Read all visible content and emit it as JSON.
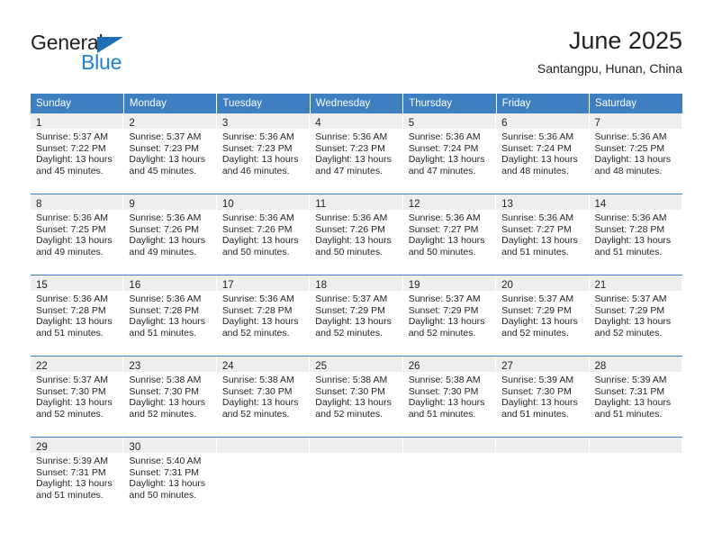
{
  "brand": {
    "line1": "General",
    "line2": "Blue",
    "triangle_color": "#1c6fb5",
    "blue_color": "#1c7fd6"
  },
  "header": {
    "title": "June 2025",
    "subtitle": "Santangpu, Hunan, China"
  },
  "theme": {
    "header_bg": "#3d7fc1",
    "daynum_bg": "#eeeeee",
    "row_divider": "#3d7fc1",
    "text": "#231f20"
  },
  "weekdays": [
    "Sunday",
    "Monday",
    "Tuesday",
    "Wednesday",
    "Thursday",
    "Friday",
    "Saturday"
  ],
  "weeks": [
    [
      {
        "day": "1",
        "sunrise": "Sunrise: 5:37 AM",
        "sunset": "Sunset: 7:22 PM",
        "daylight1": "Daylight: 13 hours",
        "daylight2": "and 45 minutes."
      },
      {
        "day": "2",
        "sunrise": "Sunrise: 5:37 AM",
        "sunset": "Sunset: 7:23 PM",
        "daylight1": "Daylight: 13 hours",
        "daylight2": "and 45 minutes."
      },
      {
        "day": "3",
        "sunrise": "Sunrise: 5:36 AM",
        "sunset": "Sunset: 7:23 PM",
        "daylight1": "Daylight: 13 hours",
        "daylight2": "and 46 minutes."
      },
      {
        "day": "4",
        "sunrise": "Sunrise: 5:36 AM",
        "sunset": "Sunset: 7:23 PM",
        "daylight1": "Daylight: 13 hours",
        "daylight2": "and 47 minutes."
      },
      {
        "day": "5",
        "sunrise": "Sunrise: 5:36 AM",
        "sunset": "Sunset: 7:24 PM",
        "daylight1": "Daylight: 13 hours",
        "daylight2": "and 47 minutes."
      },
      {
        "day": "6",
        "sunrise": "Sunrise: 5:36 AM",
        "sunset": "Sunset: 7:24 PM",
        "daylight1": "Daylight: 13 hours",
        "daylight2": "and 48 minutes."
      },
      {
        "day": "7",
        "sunrise": "Sunrise: 5:36 AM",
        "sunset": "Sunset: 7:25 PM",
        "daylight1": "Daylight: 13 hours",
        "daylight2": "and 48 minutes."
      }
    ],
    [
      {
        "day": "8",
        "sunrise": "Sunrise: 5:36 AM",
        "sunset": "Sunset: 7:25 PM",
        "daylight1": "Daylight: 13 hours",
        "daylight2": "and 49 minutes."
      },
      {
        "day": "9",
        "sunrise": "Sunrise: 5:36 AM",
        "sunset": "Sunset: 7:26 PM",
        "daylight1": "Daylight: 13 hours",
        "daylight2": "and 49 minutes."
      },
      {
        "day": "10",
        "sunrise": "Sunrise: 5:36 AM",
        "sunset": "Sunset: 7:26 PM",
        "daylight1": "Daylight: 13 hours",
        "daylight2": "and 50 minutes."
      },
      {
        "day": "11",
        "sunrise": "Sunrise: 5:36 AM",
        "sunset": "Sunset: 7:26 PM",
        "daylight1": "Daylight: 13 hours",
        "daylight2": "and 50 minutes."
      },
      {
        "day": "12",
        "sunrise": "Sunrise: 5:36 AM",
        "sunset": "Sunset: 7:27 PM",
        "daylight1": "Daylight: 13 hours",
        "daylight2": "and 50 minutes."
      },
      {
        "day": "13",
        "sunrise": "Sunrise: 5:36 AM",
        "sunset": "Sunset: 7:27 PM",
        "daylight1": "Daylight: 13 hours",
        "daylight2": "and 51 minutes."
      },
      {
        "day": "14",
        "sunrise": "Sunrise: 5:36 AM",
        "sunset": "Sunset: 7:28 PM",
        "daylight1": "Daylight: 13 hours",
        "daylight2": "and 51 minutes."
      }
    ],
    [
      {
        "day": "15",
        "sunrise": "Sunrise: 5:36 AM",
        "sunset": "Sunset: 7:28 PM",
        "daylight1": "Daylight: 13 hours",
        "daylight2": "and 51 minutes."
      },
      {
        "day": "16",
        "sunrise": "Sunrise: 5:36 AM",
        "sunset": "Sunset: 7:28 PM",
        "daylight1": "Daylight: 13 hours",
        "daylight2": "and 51 minutes."
      },
      {
        "day": "17",
        "sunrise": "Sunrise: 5:36 AM",
        "sunset": "Sunset: 7:28 PM",
        "daylight1": "Daylight: 13 hours",
        "daylight2": "and 52 minutes."
      },
      {
        "day": "18",
        "sunrise": "Sunrise: 5:37 AM",
        "sunset": "Sunset: 7:29 PM",
        "daylight1": "Daylight: 13 hours",
        "daylight2": "and 52 minutes."
      },
      {
        "day": "19",
        "sunrise": "Sunrise: 5:37 AM",
        "sunset": "Sunset: 7:29 PM",
        "daylight1": "Daylight: 13 hours",
        "daylight2": "and 52 minutes."
      },
      {
        "day": "20",
        "sunrise": "Sunrise: 5:37 AM",
        "sunset": "Sunset: 7:29 PM",
        "daylight1": "Daylight: 13 hours",
        "daylight2": "and 52 minutes."
      },
      {
        "day": "21",
        "sunrise": "Sunrise: 5:37 AM",
        "sunset": "Sunset: 7:29 PM",
        "daylight1": "Daylight: 13 hours",
        "daylight2": "and 52 minutes."
      }
    ],
    [
      {
        "day": "22",
        "sunrise": "Sunrise: 5:37 AM",
        "sunset": "Sunset: 7:30 PM",
        "daylight1": "Daylight: 13 hours",
        "daylight2": "and 52 minutes."
      },
      {
        "day": "23",
        "sunrise": "Sunrise: 5:38 AM",
        "sunset": "Sunset: 7:30 PM",
        "daylight1": "Daylight: 13 hours",
        "daylight2": "and 52 minutes."
      },
      {
        "day": "24",
        "sunrise": "Sunrise: 5:38 AM",
        "sunset": "Sunset: 7:30 PM",
        "daylight1": "Daylight: 13 hours",
        "daylight2": "and 52 minutes."
      },
      {
        "day": "25",
        "sunrise": "Sunrise: 5:38 AM",
        "sunset": "Sunset: 7:30 PM",
        "daylight1": "Daylight: 13 hours",
        "daylight2": "and 52 minutes."
      },
      {
        "day": "26",
        "sunrise": "Sunrise: 5:38 AM",
        "sunset": "Sunset: 7:30 PM",
        "daylight1": "Daylight: 13 hours",
        "daylight2": "and 51 minutes."
      },
      {
        "day": "27",
        "sunrise": "Sunrise: 5:39 AM",
        "sunset": "Sunset: 7:30 PM",
        "daylight1": "Daylight: 13 hours",
        "daylight2": "and 51 minutes."
      },
      {
        "day": "28",
        "sunrise": "Sunrise: 5:39 AM",
        "sunset": "Sunset: 7:31 PM",
        "daylight1": "Daylight: 13 hours",
        "daylight2": "and 51 minutes."
      }
    ],
    [
      {
        "day": "29",
        "sunrise": "Sunrise: 5:39 AM",
        "sunset": "Sunset: 7:31 PM",
        "daylight1": "Daylight: 13 hours",
        "daylight2": "and 51 minutes."
      },
      {
        "day": "30",
        "sunrise": "Sunrise: 5:40 AM",
        "sunset": "Sunset: 7:31 PM",
        "daylight1": "Daylight: 13 hours",
        "daylight2": "and 50 minutes."
      },
      {
        "day": "",
        "sunrise": "",
        "sunset": "",
        "daylight1": "",
        "daylight2": ""
      },
      {
        "day": "",
        "sunrise": "",
        "sunset": "",
        "daylight1": "",
        "daylight2": ""
      },
      {
        "day": "",
        "sunrise": "",
        "sunset": "",
        "daylight1": "",
        "daylight2": ""
      },
      {
        "day": "",
        "sunrise": "",
        "sunset": "",
        "daylight1": "",
        "daylight2": ""
      },
      {
        "day": "",
        "sunrise": "",
        "sunset": "",
        "daylight1": "",
        "daylight2": ""
      }
    ]
  ]
}
